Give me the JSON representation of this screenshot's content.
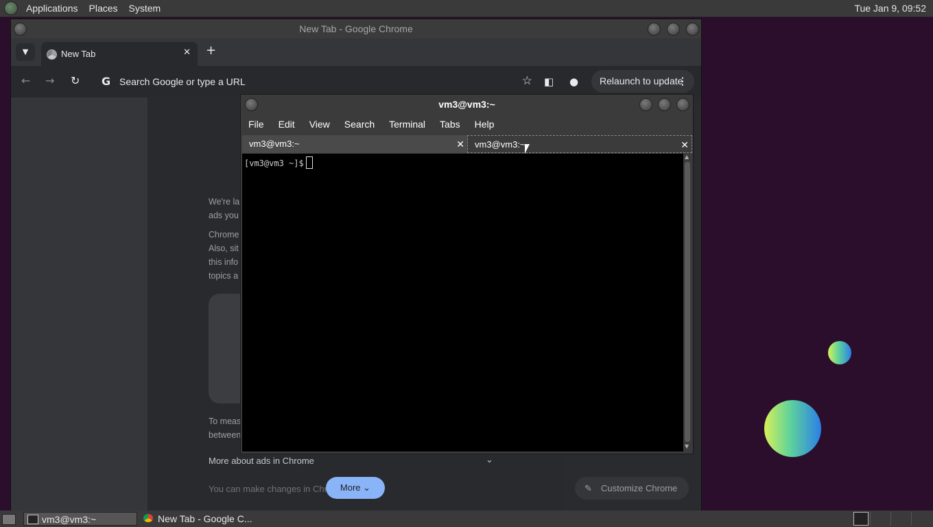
{
  "top_panel": {
    "menus": [
      "Applications",
      "Places",
      "System"
    ],
    "clock": "Tue Jan  9, 09:52"
  },
  "chrome": {
    "window_title": "New Tab - Google Chrome",
    "tab_title": "New Tab",
    "omnibox_placeholder": "Search Google or type a URL",
    "relaunch_label": "Relaunch to update",
    "dialog": {
      "fragments": [
        "We're la",
        "ads you",
        "Chrome",
        "Also, sit",
        "this info",
        "topics a",
        "To meas",
        "between"
      ],
      "more_about": "More about ads in Chrome",
      "changes": "You can make changes in Chr",
      "more_button": "More"
    },
    "customize_label": "Customize Chrome"
  },
  "terminal": {
    "window_title": "vm3@vm3:~",
    "menus": [
      "File",
      "Edit",
      "View",
      "Search",
      "Terminal",
      "Tabs",
      "Help"
    ],
    "tabs": [
      {
        "label": "vm3@vm3:~",
        "active": false
      },
      {
        "label": "vm3@vm3:~",
        "active": true
      }
    ],
    "prompt": "[vm3@vm3 ~]$"
  },
  "bottom_panel": {
    "tasks": [
      "vm3@vm3:~",
      "New Tab - Google C..."
    ]
  },
  "colors": {
    "desktop": "#2b0e2b",
    "chrome_bg": "#202124",
    "accent_button": "#8ab4f8"
  }
}
